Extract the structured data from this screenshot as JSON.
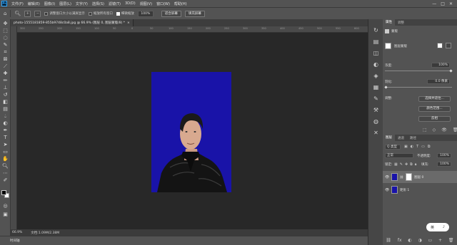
{
  "app": {
    "logo": "Ps"
  },
  "menubar": {
    "items": [
      "文件(F)",
      "编辑(E)",
      "图像(I)",
      "图层(L)",
      "文字(Y)",
      "选择(S)",
      "滤镜(T)",
      "3D(D)",
      "视图(V)",
      "窗口(W)",
      "帮助(H)"
    ],
    "window_buttons": [
      "—",
      "□",
      "✕"
    ]
  },
  "options": {
    "home_icon": "home-icon",
    "checkbox1_label": "调整窗口大小以满屏显示",
    "checkbox2_label": "缩放所有窗口",
    "checkbox3_label": "细微缩放",
    "zoom_value": "100%",
    "fit_screen": "适合屏幕",
    "fill_screen": "填充屏幕"
  },
  "document": {
    "tab_title": "photo-1555181859-855b9748c0a8.jpg @ 66.9% (图层 0, 图层蒙版/8) *",
    "close": "×",
    "ruler_ticks": [
      "300",
      "250",
      "200",
      "150",
      "100",
      "50",
      "0",
      "50",
      "100",
      "150",
      "200",
      "250",
      "300",
      "350",
      "400",
      "450",
      "500",
      "550",
      "600",
      "650",
      "700",
      "750",
      "800",
      "850",
      "900",
      "950",
      "1000",
      "1050",
      "1100",
      "1150",
      "1200",
      "1250",
      "1300",
      "1350",
      "1400",
      "1450"
    ]
  },
  "status": {
    "zoom": "66.9%",
    "doc_info": "文档:1.09M/2.38M"
  },
  "timeline": {
    "label": "时间轴"
  },
  "properties": {
    "tabs": [
      "属性",
      "调整"
    ],
    "section_label": "蒙版",
    "layer_mask_label": "图层蒙版",
    "density_label": "浓度:",
    "density_value": "100%",
    "feather_label": "羽化:",
    "feather_value": "0.0 像素",
    "adjust_label": "调整:",
    "btn_select_mask": "选择并遮住...",
    "btn_color_range": "颜色范围...",
    "btn_invert": "反相"
  },
  "layers": {
    "tabs": [
      "图层",
      "通道",
      "路径"
    ],
    "filter_label": "Q 类型",
    "blend_mode": "正常",
    "opacity_label": "不透明度:",
    "opacity_value": "100%",
    "lock_label": "锁定:",
    "fill_label": "填充:",
    "fill_value": "100%",
    "rows": [
      {
        "name": "图层 0",
        "selected": true
      },
      {
        "name": "矩形 1",
        "selected": false
      }
    ],
    "bottom_icons": [
      "⛓",
      "fx",
      "◐",
      "◑",
      "▭",
      "+",
      "🗑"
    ]
  },
  "badge": {
    "text1": "英",
    "text2": "♪"
  },
  "colors": {
    "image_bg": "#1913a8",
    "accent": "#31a8ff"
  }
}
